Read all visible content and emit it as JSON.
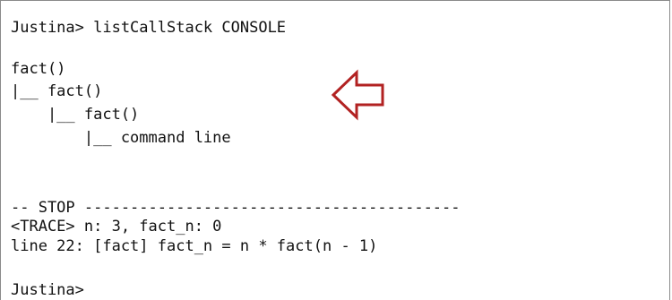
{
  "console": {
    "lines": [
      "Justina> listCallStack CONSOLE",
      "",
      "fact()",
      "|__ fact()",
      "    |__ fact()",
      "        |__ command line",
      "",
      "",
      "-- STOP -----------------------------------------",
      "<TRACE> n: 3, fact_n: 0",
      "line 22: [fact] fact_n = n * fact(n - 1)",
      "",
      "Justina>"
    ]
  },
  "colors": {
    "arrow": "#b22222",
    "text": "#111111",
    "border": "#8a8a8a"
  },
  "icons": {
    "arrow": "left-arrow-icon"
  }
}
